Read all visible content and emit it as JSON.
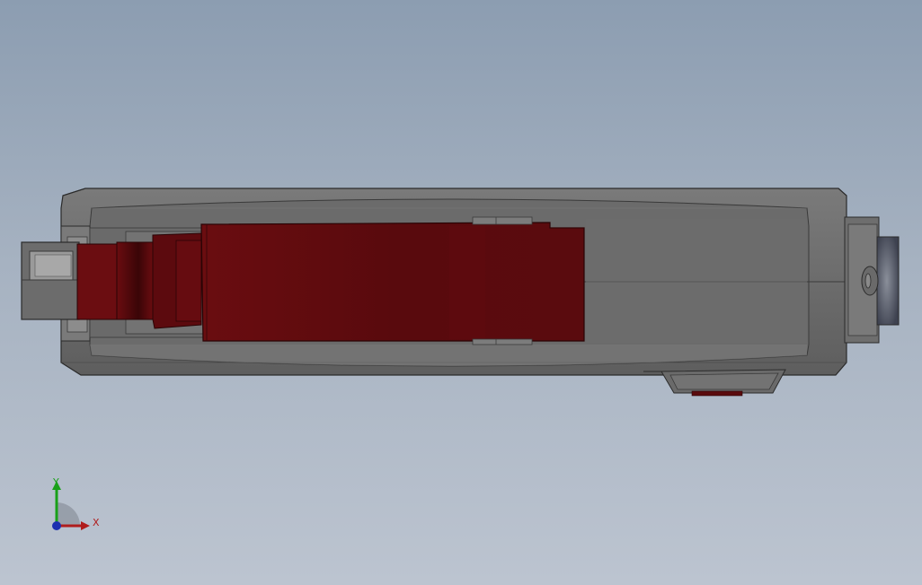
{
  "viewport": {
    "background_top": "#8c9db1",
    "background_bottom": "#bcc4d0"
  },
  "model": {
    "body_color": "#6a6a6a",
    "body_light_color": "#7e7e7e",
    "top_face_color": "#d4d4d4",
    "edge_color": "#2b2b2b",
    "cover_color": "#5a0b0e",
    "cover_dark_color": "#3c0608"
  },
  "triad": {
    "x_label": "X",
    "y_label": "Y",
    "x_color": "#b01c1c",
    "y_color": "#19a019",
    "z_color": "#1c2fb0",
    "plane_icon": "xy-plane-quarter-disc-icon"
  }
}
